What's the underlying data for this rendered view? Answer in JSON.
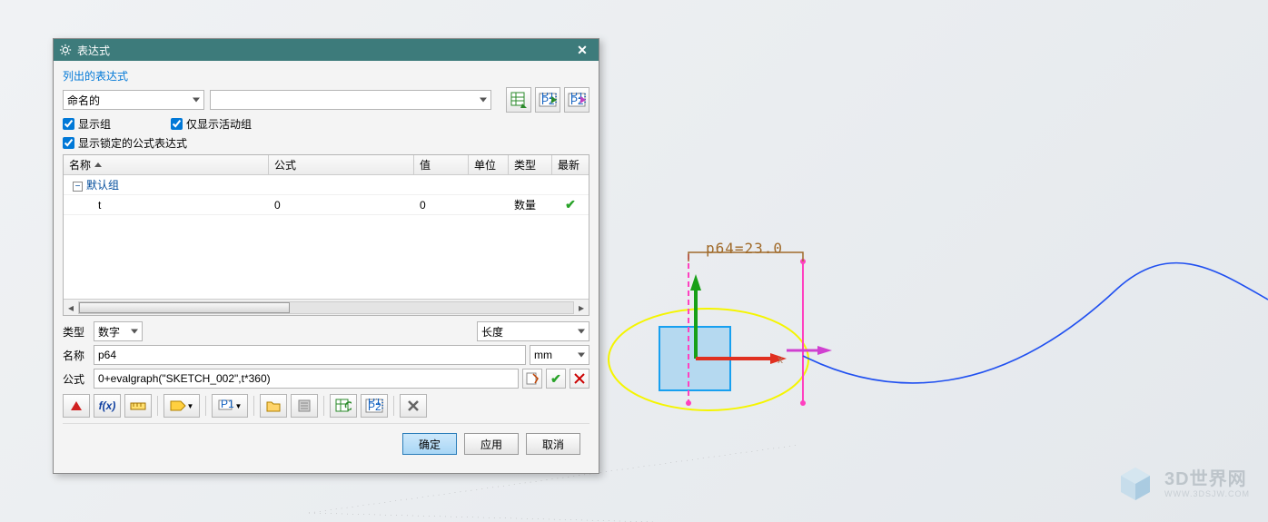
{
  "dialog": {
    "title": "表达式",
    "section_label": "列出的表达式",
    "filter_combo": "命名的",
    "chk_show_group": "显示组",
    "chk_show_active": "仅显示活动组",
    "chk_show_locked": "显示锁定的公式表达式"
  },
  "table": {
    "headers": {
      "name": "名称",
      "formula": "公式",
      "value": "值",
      "unit": "单位",
      "type": "类型",
      "new": "最新"
    },
    "group_row": "默认组",
    "rows": [
      {
        "name": "t",
        "formula": "0",
        "value": "0",
        "unit": "",
        "type": "数量",
        "ok": true
      }
    ]
  },
  "form": {
    "type_label": "类型",
    "type_value": "数字",
    "dim_value": "长度",
    "name_label": "名称",
    "name_value": "p64",
    "unit_value": "mm",
    "formula_label": "公式",
    "formula_value": "0+evalgraph(\"SKETCH_002\",t*360)"
  },
  "footer": {
    "ok": "确定",
    "apply": "应用",
    "cancel": "取消"
  },
  "canvas": {
    "dimension_text": "p64=23.0"
  },
  "watermark": {
    "text": "3D世界网",
    "url": "WWW.3DSJW.COM"
  }
}
